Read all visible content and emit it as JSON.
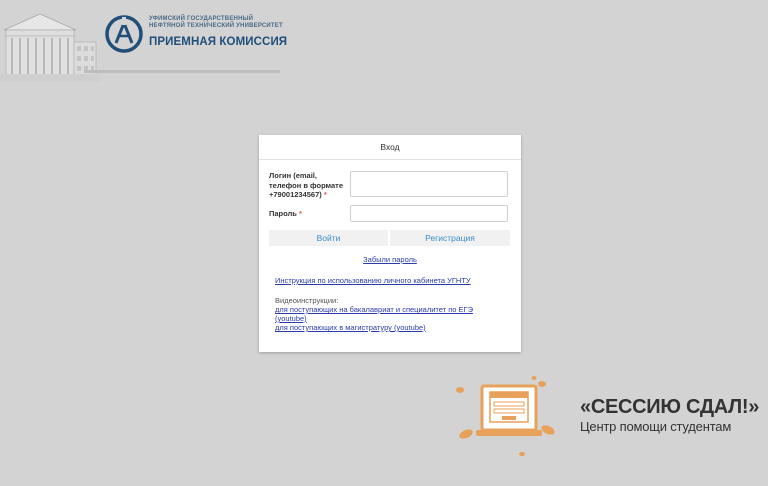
{
  "header": {
    "university_line1": "УФИМСКИЙ ГОСУДАРСТВЕННЫЙ",
    "university_line2": "НЕФТЯНОЙ ТЕХНИЧЕСКИЙ УНИВЕРСИТЕТ",
    "admissions": "ПРИЕМНАЯ КОМИССИЯ",
    "brand_color": "#1f4e79"
  },
  "login": {
    "title": "Вход",
    "login_label": "Логин (email, телефон в формате +79001234567)",
    "password_label": "Пароль",
    "required_mark": "*",
    "login_value": "",
    "password_value": "",
    "login_button": "Войти",
    "register_button": "Регистрация",
    "forgot_link": "Забыли пароль",
    "instruction_link": "Инструкция по использованию личного кабинета УГНТУ",
    "video_label": "Видеоинструкции:",
    "video_link1_line1": "для поступающих на бакалавриат и специалитет по ЕГЭ",
    "video_link1_line2": "(youtube)",
    "video_link2": "для поступающих в магистратуру (youtube)",
    "link_color": "#2a3bab",
    "button_text_color": "#3b8cc8"
  },
  "promo": {
    "title": "«СЕССИЮ СДАЛ!»",
    "subtitle": "Центр помощи студентам",
    "accent_color": "#e8a15a"
  }
}
